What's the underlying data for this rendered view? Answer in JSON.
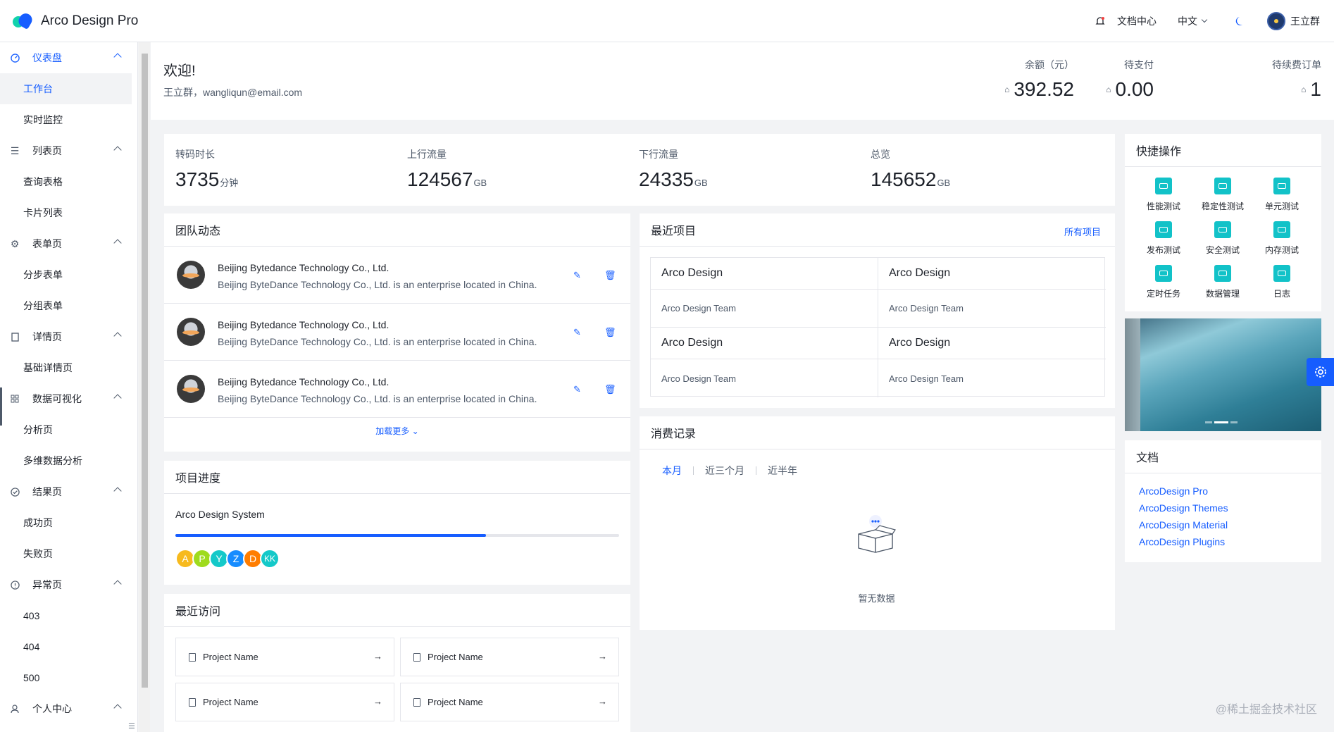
{
  "header": {
    "app_title": "Arco Design Pro",
    "docs": "文档中心",
    "language": "中文",
    "user_name": "王立群"
  },
  "sidebar": {
    "groups": [
      {
        "label": "仪表盘",
        "icon": "dashboard-icon",
        "items": [
          "工作台",
          "实时监控"
        ]
      },
      {
        "label": "列表页",
        "icon": "list-icon",
        "items": [
          "查询表格",
          "卡片列表"
        ]
      },
      {
        "label": "表单页",
        "icon": "settings-icon",
        "items": [
          "分步表单",
          "分组表单"
        ]
      },
      {
        "label": "详情页",
        "icon": "file-icon",
        "items": [
          "基础详情页"
        ]
      },
      {
        "label": "数据可视化",
        "icon": "apps-icon",
        "items": [
          "分析页",
          "多维数据分析"
        ]
      },
      {
        "label": "结果页",
        "icon": "check-circle-icon",
        "items": [
          "成功页",
          "失败页"
        ]
      },
      {
        "label": "异常页",
        "icon": "exclamation-circle-icon",
        "items": [
          "403",
          "404",
          "500"
        ]
      },
      {
        "label": "个人中心",
        "icon": "user-icon",
        "items": []
      }
    ]
  },
  "welcome": {
    "title": "欢迎!",
    "subtitle": "王立群，wangliqun@email.com",
    "stats": [
      {
        "label": "余额（元）",
        "value": "392.52"
      },
      {
        "label": "待支付",
        "value": "0.00"
      },
      {
        "label": "待续费订单",
        "value": "1"
      }
    ]
  },
  "overview": [
    {
      "label": "转码时长",
      "value": "3735",
      "unit": "分钟"
    },
    {
      "label": "上行流量",
      "value": "124567",
      "unit": "GB"
    },
    {
      "label": "下行流量",
      "value": "24335",
      "unit": "GB"
    },
    {
      "label": "总览",
      "value": "145652",
      "unit": "GB"
    }
  ],
  "team": {
    "title": "团队动态",
    "rows": [
      {
        "name": "Beijing Bytedance Technology Co., Ltd.",
        "desc": "Beijing ByteDance Technology Co., Ltd. is an enterprise located in China."
      },
      {
        "name": "Beijing Bytedance Technology Co., Ltd.",
        "desc": "Beijing ByteDance Technology Co., Ltd. is an enterprise located in China."
      },
      {
        "name": "Beijing Bytedance Technology Co., Ltd.",
        "desc": "Beijing ByteDance Technology Co., Ltd. is an enterprise located in China."
      }
    ],
    "load_more": "加载更多"
  },
  "progress": {
    "title": "项目进度",
    "name": "Arco Design System",
    "percent": 70,
    "avatars": [
      {
        "letter": "A",
        "color": "#f7ba1e"
      },
      {
        "letter": "P",
        "color": "#9fdb1d"
      },
      {
        "letter": "Y",
        "color": "#14c9c9"
      },
      {
        "letter": "Z",
        "color": "#168cff"
      },
      {
        "letter": "D",
        "color": "#ff7d00"
      },
      {
        "letter": "KK",
        "color": "#14c9c9"
      }
    ]
  },
  "recent_visits": {
    "title": "最近访问",
    "items": [
      "Project Name",
      "Project Name",
      "Project Name",
      "Project Name"
    ]
  },
  "recent_projects": {
    "title": "最近项目",
    "all_link": "所有项目",
    "cells": [
      {
        "title": "Arco Design",
        "desc": "Arco Design Team"
      },
      {
        "title": "Arco Design",
        "desc": "Arco Design Team"
      },
      {
        "title": "Arco Design",
        "desc": "Arco Design Team"
      },
      {
        "title": "Arco Design",
        "desc": "Arco Design Team"
      }
    ]
  },
  "consumption": {
    "title": "消费记录",
    "tabs": [
      "本月",
      "近三个月",
      "近半年"
    ],
    "empty": "暂无数据"
  },
  "quick_ops": {
    "title": "快捷操作",
    "items": [
      "性能测试",
      "稳定性测试",
      "单元测试",
      "发布测试",
      "安全测试",
      "内存测试",
      "定时任务",
      "数据管理",
      "日志"
    ]
  },
  "docs": {
    "title": "文档",
    "links": [
      "ArcoDesign Pro",
      "ArcoDesign Themes",
      "ArcoDesign Material",
      "ArcoDesign Plugins"
    ]
  },
  "watermark": "@稀土掘金技术社区",
  "colors": {
    "primary": "#165dff",
    "teal": "#12c2c8"
  }
}
